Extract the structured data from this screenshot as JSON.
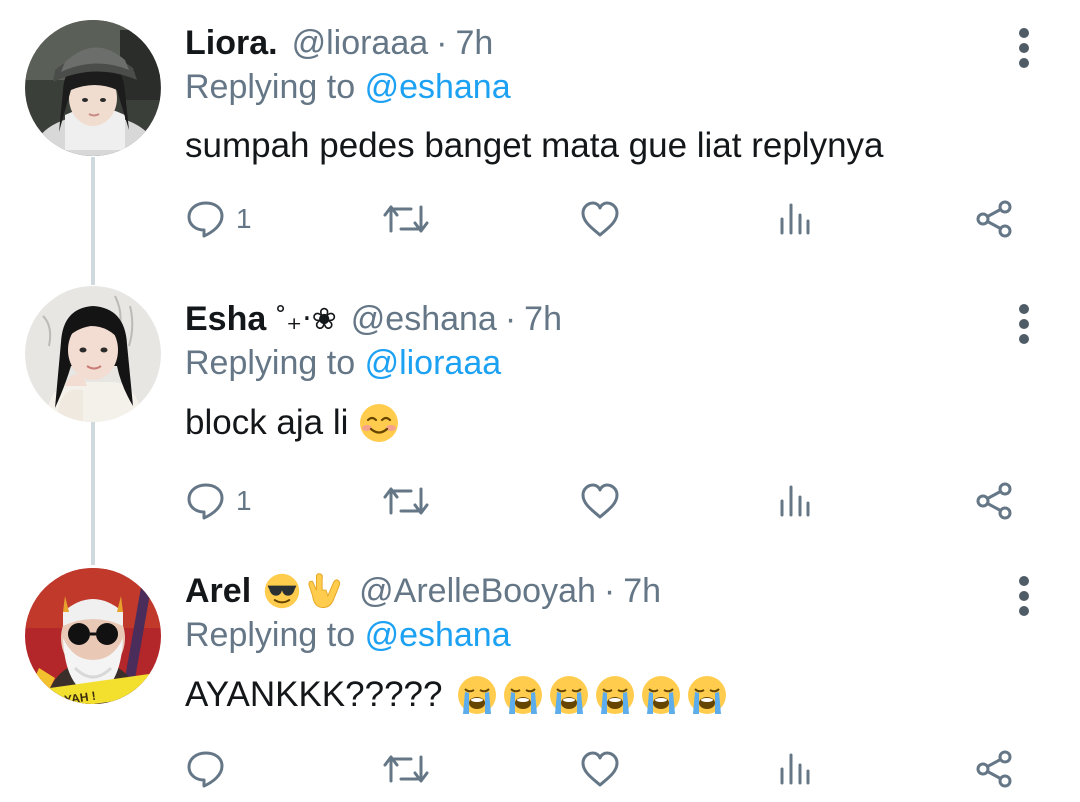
{
  "thread": [
    {
      "name": "Liora.",
      "name_extra": "",
      "handle": "@lioraaa",
      "separator": "·",
      "time": "7h",
      "replying_prefix": "Replying to",
      "replying_to": "@eshana",
      "text": "sumpah pedes banget mata gue liat replynya",
      "reply_count": "1",
      "icons": {
        "avatar": "avatar-girl-cap",
        "emoji": ""
      }
    },
    {
      "name": "Esha",
      "name_extra": "˚₊‧❀",
      "handle": "@eshana",
      "separator": "·",
      "time": "7h",
      "replying_prefix": "Replying to",
      "replying_to": "@lioraaa",
      "text": "block aja li",
      "reply_count": "1",
      "icons": {
        "avatar": "avatar-girl-longhair",
        "emoji": "smiling-face-emoji"
      }
    },
    {
      "name": "Arel",
      "name_extra": "",
      "handle": "@ArelleBooyah",
      "separator": "·",
      "time": "7h",
      "replying_prefix": "Replying to",
      "replying_to": "@eshana",
      "text": "AYANKKK?????",
      "reply_count": "",
      "avatar_badge": "OOYAH !",
      "icons": {
        "avatar": "avatar-game-character",
        "name_emoji": [
          "sunglasses-emoji",
          "love-you-gesture-emoji"
        ],
        "emoji": "loudly-crying-face-emoji",
        "emoji_repeat": 6
      }
    }
  ],
  "colors": {
    "text": "#14171a",
    "secondary": "#657786",
    "link": "#1da1f2",
    "thread_line": "#cfd9de",
    "icon": "#657786"
  }
}
